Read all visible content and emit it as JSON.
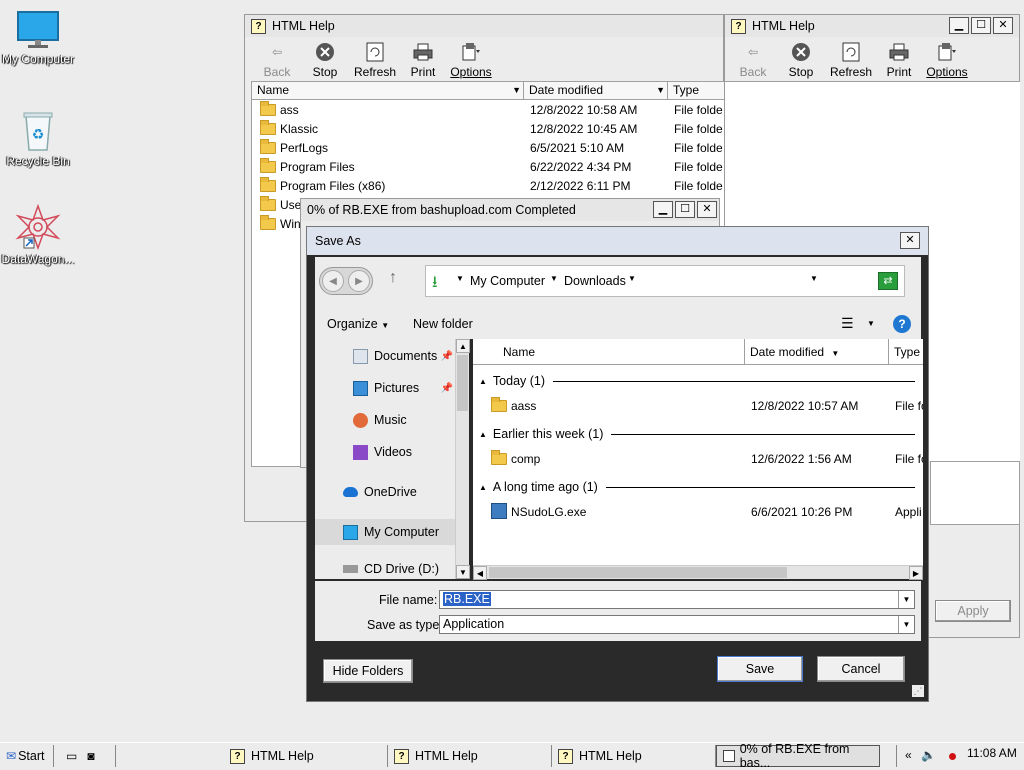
{
  "desktop": {
    "icons": [
      {
        "label": "My Computer",
        "icon": "monitor-icon"
      },
      {
        "label": "Recycle Bin",
        "icon": "recycle-bin-icon"
      },
      {
        "label": "DataWagon...",
        "icon": "datawagon-icon"
      }
    ]
  },
  "help_window_1": {
    "title": "HTML Help",
    "toolbar": {
      "back": "Back",
      "stop": "Stop",
      "refresh": "Refresh",
      "print": "Print",
      "options": "Options"
    },
    "columns": {
      "name": "Name",
      "date": "Date modified",
      "type": "Type"
    },
    "rows": [
      {
        "name": "ass",
        "date": "12/8/2022 10:58 AM",
        "type": "File folde"
      },
      {
        "name": "Klassic",
        "date": "12/8/2022 10:45 AM",
        "type": "File folde"
      },
      {
        "name": "PerfLogs",
        "date": "6/5/2021 5:10 AM",
        "type": "File folde"
      },
      {
        "name": "Program Files",
        "date": "6/22/2022 4:34 PM",
        "type": "File folde"
      },
      {
        "name": "Program Files (x86)",
        "date": "2/12/2022 6:11 PM",
        "type": "File folde"
      },
      {
        "name": "Use",
        "date": "",
        "type": ""
      },
      {
        "name": "Win",
        "date": "",
        "type": ""
      }
    ]
  },
  "help_window_2": {
    "title": "HTML Help",
    "toolbar": {
      "back": "Back",
      "stop": "Stop",
      "refresh": "Refresh",
      "print": "Print",
      "options": "Options"
    },
    "apply": "Apply"
  },
  "download_window": {
    "title": "0% of RB.EXE from bashupload.com Completed"
  },
  "save_as": {
    "title": "Save As",
    "breadcrumb": [
      "My Computer",
      "Downloads"
    ],
    "organize": "Organize",
    "new_folder": "New folder",
    "nav": [
      {
        "label": "Documents",
        "icon": "documents-icon",
        "pinned": true
      },
      {
        "label": "Pictures",
        "icon": "pictures-icon",
        "pinned": true
      },
      {
        "label": "Music",
        "icon": "music-icon",
        "pinned": false
      },
      {
        "label": "Videos",
        "icon": "videos-icon",
        "pinned": false
      },
      {
        "label": "OneDrive",
        "icon": "onedrive-icon",
        "pinned": false
      },
      {
        "label": "My Computer",
        "icon": "computer-icon",
        "pinned": false
      },
      {
        "label": "CD Drive (D:)",
        "icon": "cd-drive-icon",
        "pinned": false
      }
    ],
    "columns": {
      "name": "Name",
      "date": "Date modified",
      "type": "Type"
    },
    "groups": [
      {
        "header": "Today (1)",
        "items": [
          {
            "name": "aass",
            "date": "12/8/2022 10:57 AM",
            "type": "File fo",
            "icon": "folder-icon"
          }
        ]
      },
      {
        "header": "Earlier this week (1)",
        "items": [
          {
            "name": "comp",
            "date": "12/6/2022 1:56 AM",
            "type": "File fo",
            "icon": "folder-icon"
          }
        ]
      },
      {
        "header": "A long time ago (1)",
        "items": [
          {
            "name": "NSudoLG.exe",
            "date": "6/6/2021 10:26 PM",
            "type": "Appli",
            "icon": "exe-icon"
          }
        ]
      }
    ],
    "file_name_label": "File name:",
    "file_name_value": "RB.EXE",
    "save_type_label": "Save as type:",
    "save_type_value": "Application",
    "hide_folders": "Hide Folders",
    "save": "Save",
    "cancel": "Cancel"
  },
  "taskbar": {
    "start": "Start",
    "tasks": [
      "HTML Help",
      "HTML Help",
      "HTML Help",
      "0% of RB.EXE from bas..."
    ],
    "clock": "11:08 AM"
  }
}
